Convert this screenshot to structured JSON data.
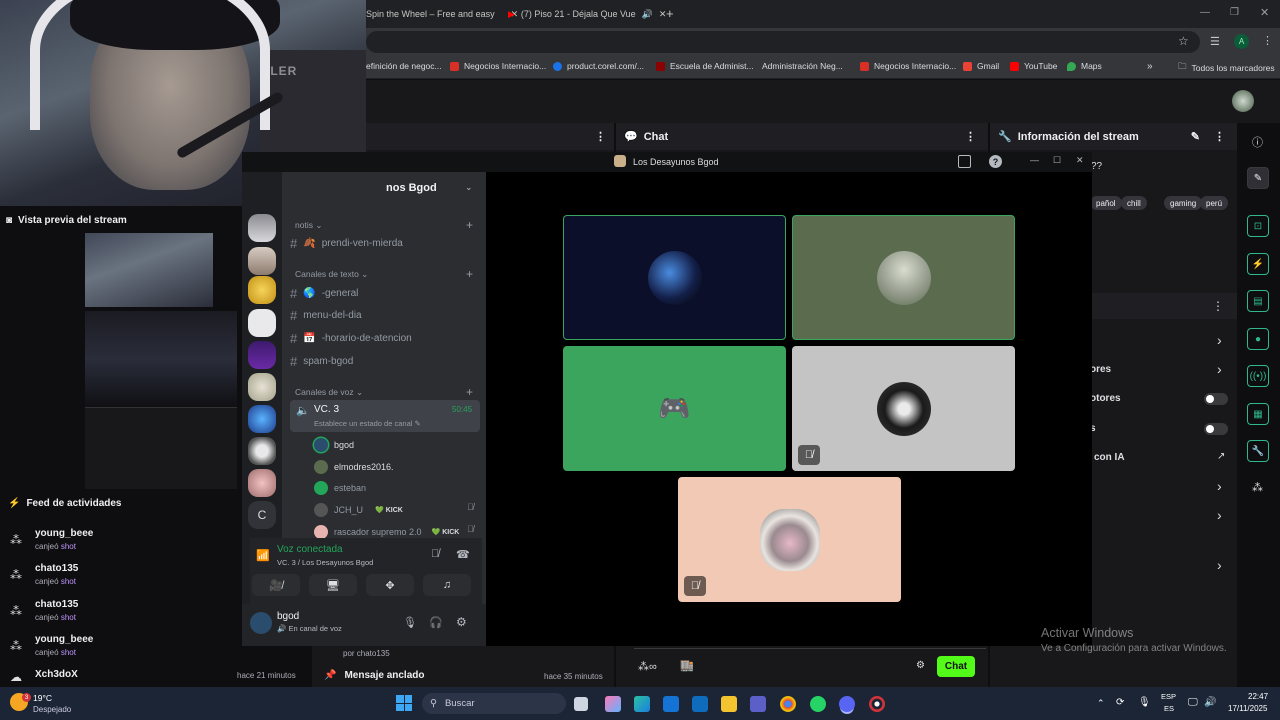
{
  "browser": {
    "tabs": [
      {
        "label": "Spin the Wheel – Free and easy"
      },
      {
        "label": "(7) Piso 21 - Déjala Que Vue"
      }
    ],
    "bookmarks": [
      {
        "label": "efinición de negoc...",
        "color": "#555"
      },
      {
        "label": "Negocios Internacio...",
        "color": "#d93025"
      },
      {
        "label": "product.corel.com/...",
        "color": "#1a73e8"
      },
      {
        "label": "Escuela de Administ...",
        "color": "#8b0000"
      },
      {
        "label": "Administración Neg...",
        "color": "#444"
      },
      {
        "label": "Negocios Internacio...",
        "color": "#d93025"
      },
      {
        "label": "Gmail",
        "color": "#ea4335"
      },
      {
        "label": "YouTube",
        "color": "#ff0000"
      },
      {
        "label": "Maps",
        "color": "#34a853"
      }
    ],
    "bookmarks_folder": "Todos los marcadores",
    "profile_letter": "A"
  },
  "camera": {
    "brand_text": "ZLER"
  },
  "stream_preview": {
    "title": "Vista previa del stream"
  },
  "activity_feed": {
    "title": "Feed de actividades",
    "items": [
      {
        "user": "young_beee",
        "action": "canjeó",
        "reward": "shot"
      },
      {
        "user": "chato135",
        "action": "canjeó",
        "reward": "shot"
      },
      {
        "user": "chato135",
        "action": "canjeó",
        "reward": "shot"
      },
      {
        "user": "young_beee",
        "action": "canjeó",
        "reward": "shot"
      },
      {
        "user": "Xch3doX",
        "time": "hace 21 minutos"
      }
    ]
  },
  "chat_panel": {
    "title": "Chat",
    "by_line": "por chato135",
    "pinned_label": "Mensaje anclado",
    "pinned_time": "hace 35 minutos",
    "chat_button": "Chat"
  },
  "stream_info": {
    "title": "Información del stream",
    "question": "??",
    "tags": [
      "pañol",
      "chill",
      "gaming",
      "perú"
    ],
    "rows": [
      "ores",
      "otores",
      "s",
      "con IA"
    ]
  },
  "discord": {
    "window_title": "Los Desayunos Bgod",
    "server_name": "nos Bgod",
    "categories": {
      "notis": "notis",
      "text": "Canales de texto",
      "voice": "Canales de voz"
    },
    "channels": {
      "prendi": "prendi-ven-mierda",
      "general": "-general",
      "menu": "menu-del-dia",
      "horario": "-horario-de-atencion",
      "spam": "spam-bgod"
    },
    "voice_channel": {
      "name": "VC. 3",
      "timer": "50:45",
      "status_placeholder": "Establece un estado de canal",
      "users": [
        {
          "name": "bgod",
          "color": "#2a4d6e",
          "badge": ""
        },
        {
          "name": "elmodres2016.",
          "color": "#5a6b4e",
          "badge": ""
        },
        {
          "name": "esteban",
          "color": "#23a55a",
          "badge": ""
        },
        {
          "name": "JCH_U",
          "color": "#555",
          "badge": "KICK"
        },
        {
          "name": "rascador supremo 2.0",
          "color": "#e8b4b0",
          "badge": "KICK"
        }
      ]
    },
    "server_letter": "C",
    "voice_status": {
      "title": "Voz conectada",
      "subtitle": "VC. 3 / Los Desayunos Bgod"
    },
    "user_panel": {
      "name": "bgod",
      "status": "En canal de voz"
    }
  },
  "watermark": {
    "title": "Activar Windows",
    "subtitle": "Ve a Configuración para activar Windows."
  },
  "taskbar": {
    "weather_temp": "19°C",
    "weather_desc": "Despejado",
    "search_placeholder": "Buscar",
    "lang_top": "ESP",
    "lang_bottom": "ES",
    "time": "22:47",
    "date": "17/11/2025",
    "notification_count": "3"
  }
}
